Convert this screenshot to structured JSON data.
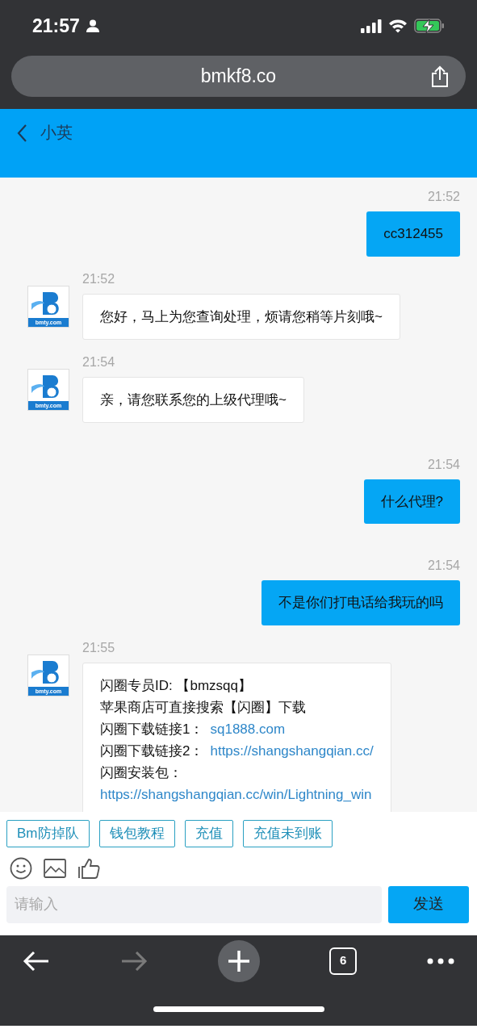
{
  "status_bar": {
    "time": "21:57"
  },
  "address_bar": {
    "url": "bmkf8.co"
  },
  "header": {
    "title": "小英"
  },
  "messages": [
    {
      "kind": "user",
      "time": "21:52",
      "lines": [
        {
          "text": "cc312455"
        }
      ]
    },
    {
      "kind": "agent",
      "time": "21:52",
      "avatar_label": "bmty.com",
      "lines": [
        {
          "text": "您好，马上为您查询处理，烦请您稍等片刻哦~"
        }
      ]
    },
    {
      "kind": "agent",
      "time": "21:54",
      "avatar_label": "bmty.com",
      "lines": [
        {
          "text": "亲，请您联系您的上级代理哦~"
        }
      ]
    },
    {
      "kind": "user",
      "time": "21:54",
      "lines": [
        {
          "text": "什么代理?"
        }
      ]
    },
    {
      "kind": "user",
      "time": "21:54",
      "lines": [
        {
          "text": "不是你们打电话给我玩的吗"
        }
      ]
    },
    {
      "kind": "agent",
      "time": "21:55",
      "avatar_label": "bmty.com",
      "lines": [
        {
          "text": "闪圈专员ID: 【bmzsqq】"
        },
        {
          "text": "苹果商店可直接搜索【闪圈】下载"
        },
        {
          "text": "闪圈下载链接1：",
          "link": "sq1888.com"
        },
        {
          "text": "闪圈下载链接2：",
          "link": "https://shangshangqian.cc/"
        },
        {
          "text": "闪圈安装包："
        },
        {
          "link": "https://shangshangqian.cc/win/Lightning_win"
        }
      ]
    }
  ],
  "quick_replies": [
    "Bm防掉队",
    "钱包教程",
    "充值",
    "充值未到账"
  ],
  "composer": {
    "placeholder": "请输入",
    "send_label": "发送"
  },
  "toolbar": {
    "back_disabled": false,
    "forward_disabled": true,
    "tab_count": "6"
  }
}
